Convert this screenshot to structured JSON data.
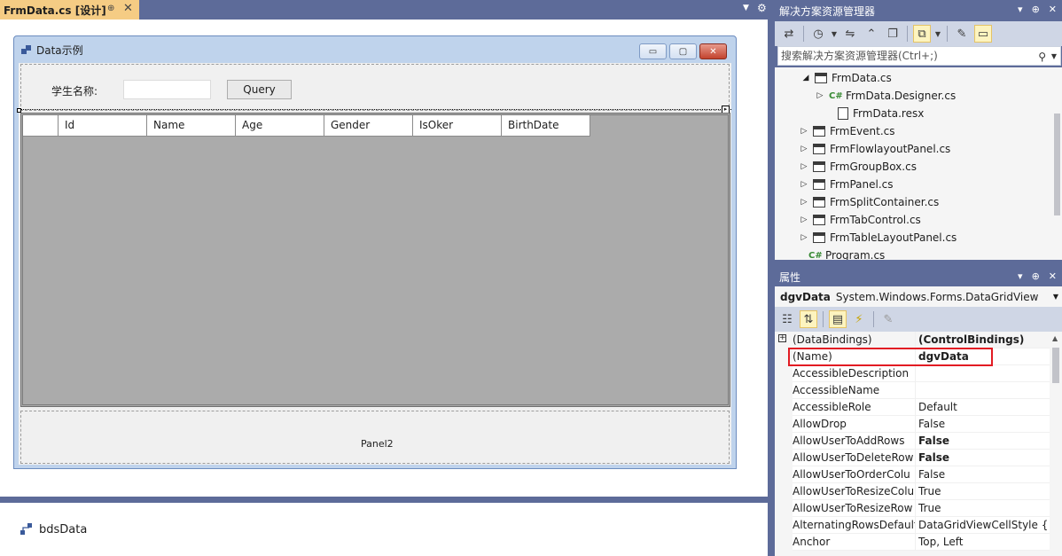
{
  "document_tab": {
    "title": "FrmData.cs [设计]",
    "pin": "⊕",
    "close": "✕"
  },
  "doc_tabbar_controls": {
    "dropdown": "▼",
    "gear": "⚙"
  },
  "form": {
    "title": "Data示例",
    "buttons": {
      "minimize": "▭",
      "maximize": "▢",
      "close": "✕"
    },
    "student_label": "学生名称:",
    "student_input_value": "",
    "query_button": "Query",
    "grid_columns": [
      "",
      "Id",
      "Name",
      "Age",
      "Gender",
      "IsOker",
      "BirthDate"
    ],
    "panel2_caption": "Panel2"
  },
  "component_tray": {
    "items": [
      {
        "label": "bdsData",
        "icon": "binding-source-icon"
      }
    ]
  },
  "solution_explorer": {
    "title": "解决方案资源管理器",
    "header_buttons": [
      "▾",
      "⊕",
      "✕"
    ],
    "search_placeholder": "搜索解决方案资源管理器(Ctrl+;)",
    "tree": [
      {
        "label": "FrmData.cs",
        "icon": "form-icon",
        "twisty": "◢",
        "indent": 0
      },
      {
        "label": "FrmData.Designer.cs",
        "icon": "csharp-icon",
        "twisty": "▷",
        "indent": 1
      },
      {
        "label": "FrmData.resx",
        "icon": "resx-icon",
        "twisty": "",
        "indent": 1
      },
      {
        "label": "FrmEvent.cs",
        "icon": "form-icon",
        "twisty": "▷",
        "indent": 0
      },
      {
        "label": "FrmFlowlayoutPanel.cs",
        "icon": "form-icon",
        "twisty": "▷",
        "indent": 0
      },
      {
        "label": "FrmGroupBox.cs",
        "icon": "form-icon",
        "twisty": "▷",
        "indent": 0
      },
      {
        "label": "FrmPanel.cs",
        "icon": "form-icon",
        "twisty": "▷",
        "indent": 0
      },
      {
        "label": "FrmSplitContainer.cs",
        "icon": "form-icon",
        "twisty": "▷",
        "indent": 0
      },
      {
        "label": "FrmTabControl.cs",
        "icon": "form-icon",
        "twisty": "▷",
        "indent": 0
      },
      {
        "label": "FrmTableLayoutPanel.cs",
        "icon": "form-icon",
        "twisty": "▷",
        "indent": 0
      },
      {
        "label": "Program.cs",
        "icon": "csharp-icon",
        "twisty": "",
        "indent": 0
      }
    ]
  },
  "properties": {
    "title": "属性",
    "header_buttons": [
      "▾",
      "⊕",
      "✕"
    ],
    "object_name": "dgvData",
    "object_type": "System.Windows.Forms.DataGridView",
    "rows": [
      {
        "key": "(DataBindings)",
        "value": "(ControlBindings)",
        "bold": true,
        "expandable": true
      },
      {
        "key": "(Name)",
        "value": "dgvData",
        "bold": true,
        "expandable": false
      },
      {
        "key": "AccessibleDescription",
        "value": "",
        "bold": false,
        "expandable": false
      },
      {
        "key": "AccessibleName",
        "value": "",
        "bold": false,
        "expandable": false
      },
      {
        "key": "AccessibleRole",
        "value": "Default",
        "bold": false,
        "expandable": false
      },
      {
        "key": "AllowDrop",
        "value": "False",
        "bold": false,
        "expandable": false
      },
      {
        "key": "AllowUserToAddRows",
        "value": "False",
        "bold": true,
        "expandable": false
      },
      {
        "key": "AllowUserToDeleteRow",
        "value": "False",
        "bold": true,
        "expandable": false
      },
      {
        "key": "AllowUserToOrderColu",
        "value": "False",
        "bold": false,
        "expandable": false
      },
      {
        "key": "AllowUserToResizeColu",
        "value": "True",
        "bold": false,
        "expandable": false
      },
      {
        "key": "AllowUserToResizeRow",
        "value": "True",
        "bold": false,
        "expandable": false
      },
      {
        "key": "AlternatingRowsDefault",
        "value": "DataGridViewCellStyle { }",
        "bold": false,
        "expandable": false
      },
      {
        "key": "Anchor",
        "value": "Top, Left",
        "bold": false,
        "expandable": false
      }
    ]
  },
  "colors": {
    "accent_tab": "#f5cc84",
    "chrome": "#5d6b99",
    "highlight_box": "#e21b23"
  }
}
